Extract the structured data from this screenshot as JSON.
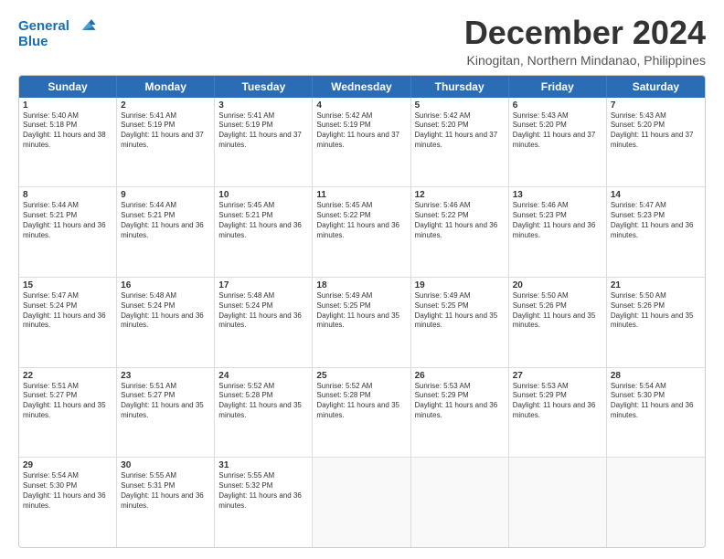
{
  "logo": {
    "line1": "General",
    "line2": "Blue"
  },
  "title": "December 2024",
  "location": "Kinogitan, Northern Mindanao, Philippines",
  "header": {
    "days": [
      "Sunday",
      "Monday",
      "Tuesday",
      "Wednesday",
      "Thursday",
      "Friday",
      "Saturday"
    ]
  },
  "weeks": [
    [
      {
        "day": "1",
        "sunrise": "5:40 AM",
        "sunset": "5:18 PM",
        "daylight": "11 hours and 38 minutes."
      },
      {
        "day": "2",
        "sunrise": "5:41 AM",
        "sunset": "5:19 PM",
        "daylight": "11 hours and 37 minutes."
      },
      {
        "day": "3",
        "sunrise": "5:41 AM",
        "sunset": "5:19 PM",
        "daylight": "11 hours and 37 minutes."
      },
      {
        "day": "4",
        "sunrise": "5:42 AM",
        "sunset": "5:19 PM",
        "daylight": "11 hours and 37 minutes."
      },
      {
        "day": "5",
        "sunrise": "5:42 AM",
        "sunset": "5:20 PM",
        "daylight": "11 hours and 37 minutes."
      },
      {
        "day": "6",
        "sunrise": "5:43 AM",
        "sunset": "5:20 PM",
        "daylight": "11 hours and 37 minutes."
      },
      {
        "day": "7",
        "sunrise": "5:43 AM",
        "sunset": "5:20 PM",
        "daylight": "11 hours and 37 minutes."
      }
    ],
    [
      {
        "day": "8",
        "sunrise": "5:44 AM",
        "sunset": "5:21 PM",
        "daylight": "11 hours and 36 minutes."
      },
      {
        "day": "9",
        "sunrise": "5:44 AM",
        "sunset": "5:21 PM",
        "daylight": "11 hours and 36 minutes."
      },
      {
        "day": "10",
        "sunrise": "5:45 AM",
        "sunset": "5:21 PM",
        "daylight": "11 hours and 36 minutes."
      },
      {
        "day": "11",
        "sunrise": "5:45 AM",
        "sunset": "5:22 PM",
        "daylight": "11 hours and 36 minutes."
      },
      {
        "day": "12",
        "sunrise": "5:46 AM",
        "sunset": "5:22 PM",
        "daylight": "11 hours and 36 minutes."
      },
      {
        "day": "13",
        "sunrise": "5:46 AM",
        "sunset": "5:23 PM",
        "daylight": "11 hours and 36 minutes."
      },
      {
        "day": "14",
        "sunrise": "5:47 AM",
        "sunset": "5:23 PM",
        "daylight": "11 hours and 36 minutes."
      }
    ],
    [
      {
        "day": "15",
        "sunrise": "5:47 AM",
        "sunset": "5:24 PM",
        "daylight": "11 hours and 36 minutes."
      },
      {
        "day": "16",
        "sunrise": "5:48 AM",
        "sunset": "5:24 PM",
        "daylight": "11 hours and 36 minutes."
      },
      {
        "day": "17",
        "sunrise": "5:48 AM",
        "sunset": "5:24 PM",
        "daylight": "11 hours and 36 minutes."
      },
      {
        "day": "18",
        "sunrise": "5:49 AM",
        "sunset": "5:25 PM",
        "daylight": "11 hours and 35 minutes."
      },
      {
        "day": "19",
        "sunrise": "5:49 AM",
        "sunset": "5:25 PM",
        "daylight": "11 hours and 35 minutes."
      },
      {
        "day": "20",
        "sunrise": "5:50 AM",
        "sunset": "5:26 PM",
        "daylight": "11 hours and 35 minutes."
      },
      {
        "day": "21",
        "sunrise": "5:50 AM",
        "sunset": "5:26 PM",
        "daylight": "11 hours and 35 minutes."
      }
    ],
    [
      {
        "day": "22",
        "sunrise": "5:51 AM",
        "sunset": "5:27 PM",
        "daylight": "11 hours and 35 minutes."
      },
      {
        "day": "23",
        "sunrise": "5:51 AM",
        "sunset": "5:27 PM",
        "daylight": "11 hours and 35 minutes."
      },
      {
        "day": "24",
        "sunrise": "5:52 AM",
        "sunset": "5:28 PM",
        "daylight": "11 hours and 35 minutes."
      },
      {
        "day": "25",
        "sunrise": "5:52 AM",
        "sunset": "5:28 PM",
        "daylight": "11 hours and 35 minutes."
      },
      {
        "day": "26",
        "sunrise": "5:53 AM",
        "sunset": "5:29 PM",
        "daylight": "11 hours and 36 minutes."
      },
      {
        "day": "27",
        "sunrise": "5:53 AM",
        "sunset": "5:29 PM",
        "daylight": "11 hours and 36 minutes."
      },
      {
        "day": "28",
        "sunrise": "5:54 AM",
        "sunset": "5:30 PM",
        "daylight": "11 hours and 36 minutes."
      }
    ],
    [
      {
        "day": "29",
        "sunrise": "5:54 AM",
        "sunset": "5:30 PM",
        "daylight": "11 hours and 36 minutes."
      },
      {
        "day": "30",
        "sunrise": "5:55 AM",
        "sunset": "5:31 PM",
        "daylight": "11 hours and 36 minutes."
      },
      {
        "day": "31",
        "sunrise": "5:55 AM",
        "sunset": "5:32 PM",
        "daylight": "11 hours and 36 minutes."
      },
      null,
      null,
      null,
      null
    ]
  ],
  "labels": {
    "sunrise": "Sunrise:",
    "sunset": "Sunset:",
    "daylight": "Daylight:"
  }
}
